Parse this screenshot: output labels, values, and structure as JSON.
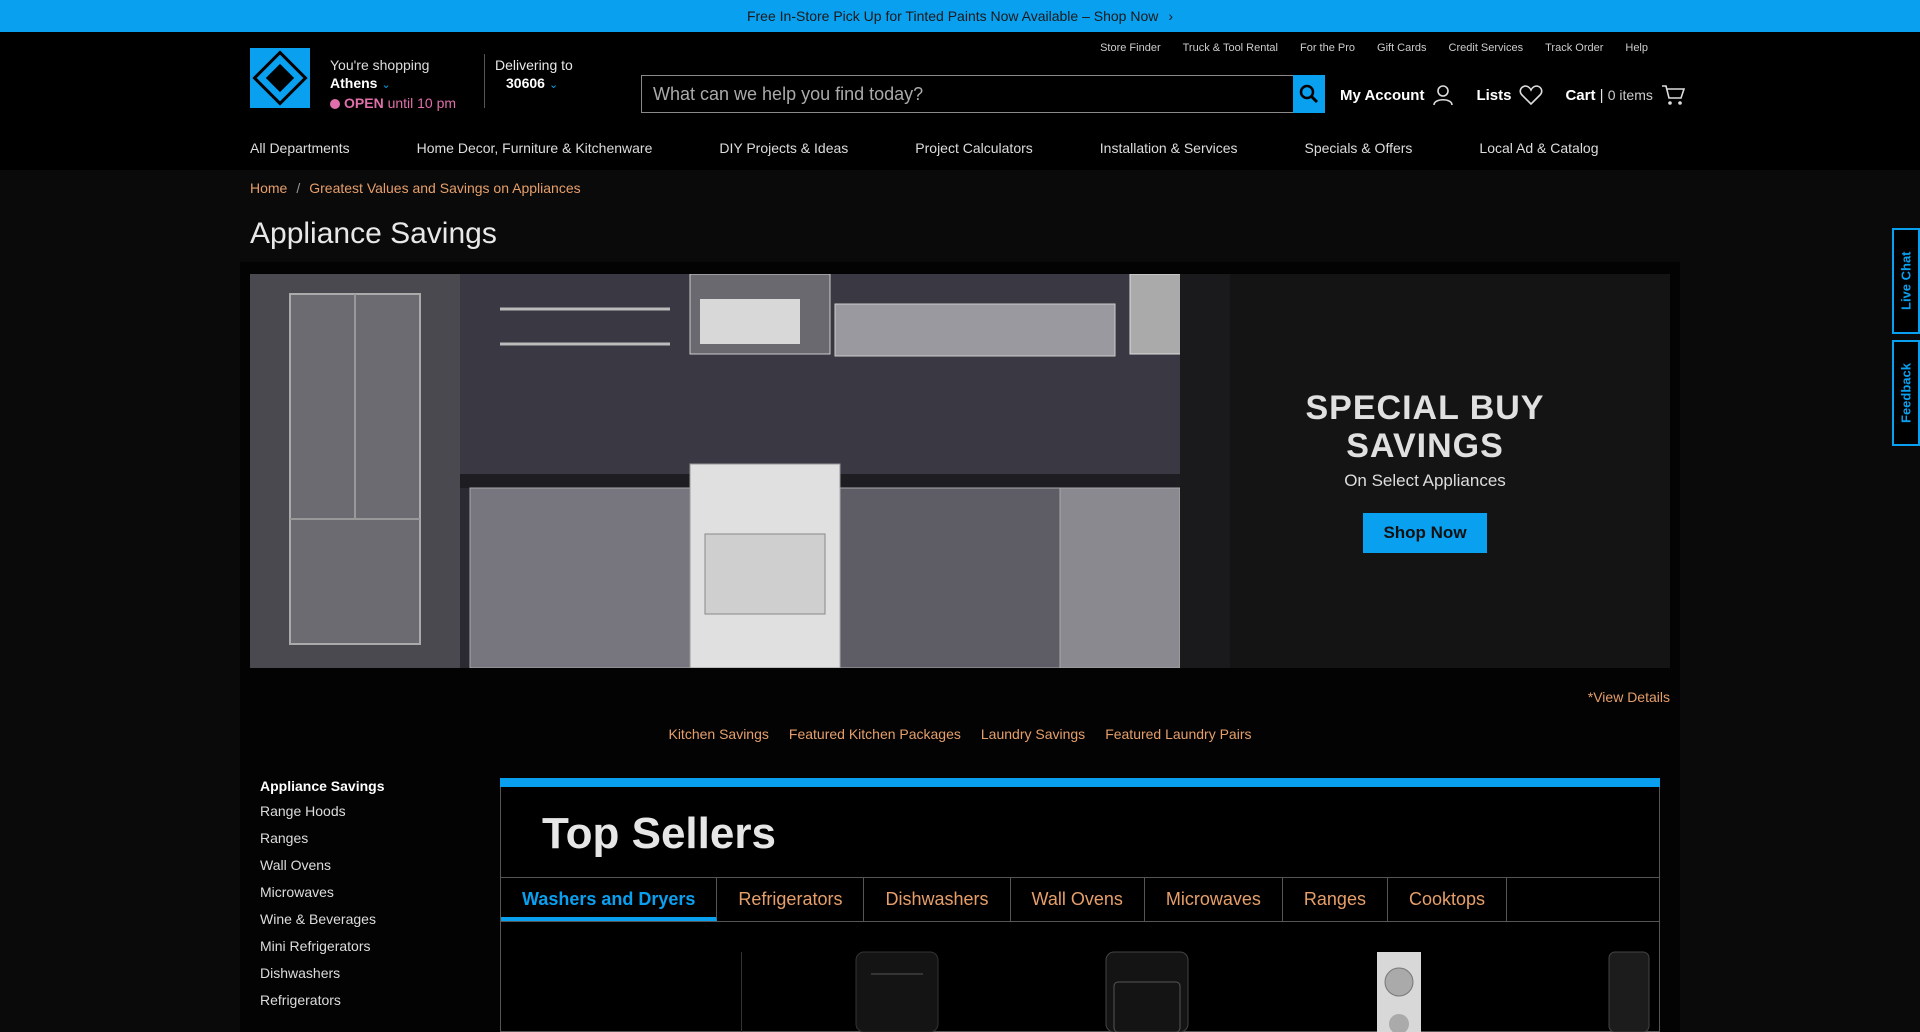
{
  "promo": {
    "text": "Free In-Store Pick Up for Tinted Paints Now Available – Shop Now",
    "chevron": "›"
  },
  "store": {
    "label": "You're shopping",
    "city": "Athens",
    "status_bold": "OPEN",
    "status_rest": "until 10 pm"
  },
  "delivery": {
    "label": "Delivering to",
    "zip": "30606"
  },
  "util_links": [
    "Store Finder",
    "Truck & Tool Rental",
    "For the Pro",
    "Gift Cards",
    "Credit Services",
    "Track Order",
    "Help"
  ],
  "search": {
    "placeholder": "What can we help you find today?"
  },
  "account": {
    "my_account": "My Account",
    "lists": "Lists",
    "cart": "Cart",
    "cart_sep": "|",
    "cart_count": "0 items"
  },
  "nav": [
    "All Departments",
    "Home Decor, Furniture & Kitchenware",
    "DIY Projects & Ideas",
    "Project Calculators",
    "Installation & Services",
    "Specials & Offers",
    "Local Ad & Catalog"
  ],
  "breadcrumb": {
    "home": "Home",
    "sep": "/",
    "current": "Greatest Values and Savings on Appliances"
  },
  "page_title": "Appliance Savings",
  "hero": {
    "headline_1": "SPECIAL BUY",
    "headline_2": "SAVINGS",
    "sub": "On Select Appliances",
    "button": "Shop Now"
  },
  "view_details": "*View Details",
  "quick_links": [
    "Kitchen Savings",
    "Featured Kitchen Packages",
    "Laundry Savings",
    "Featured Laundry Pairs"
  ],
  "side_nav": {
    "head": "Appliance Savings",
    "items": [
      "Range Hoods",
      "Ranges",
      "Wall Ovens",
      "Microwaves",
      "Wine & Beverages",
      "Mini Refrigerators",
      "Dishwashers",
      "Refrigerators"
    ]
  },
  "top_sellers": {
    "title": "Top Sellers",
    "tabs": [
      "Washers and Dryers",
      "Refrigerators",
      "Dishwashers",
      "Wall Ovens",
      "Microwaves",
      "Ranges",
      "Cooktops"
    ]
  },
  "side_tabs": {
    "chat": "Live Chat",
    "feedback": "Feedback"
  },
  "colors": {
    "brand_blue": "#0aa0f0",
    "link_orange": "#e69f6a",
    "open_pink": "#e06faa"
  }
}
